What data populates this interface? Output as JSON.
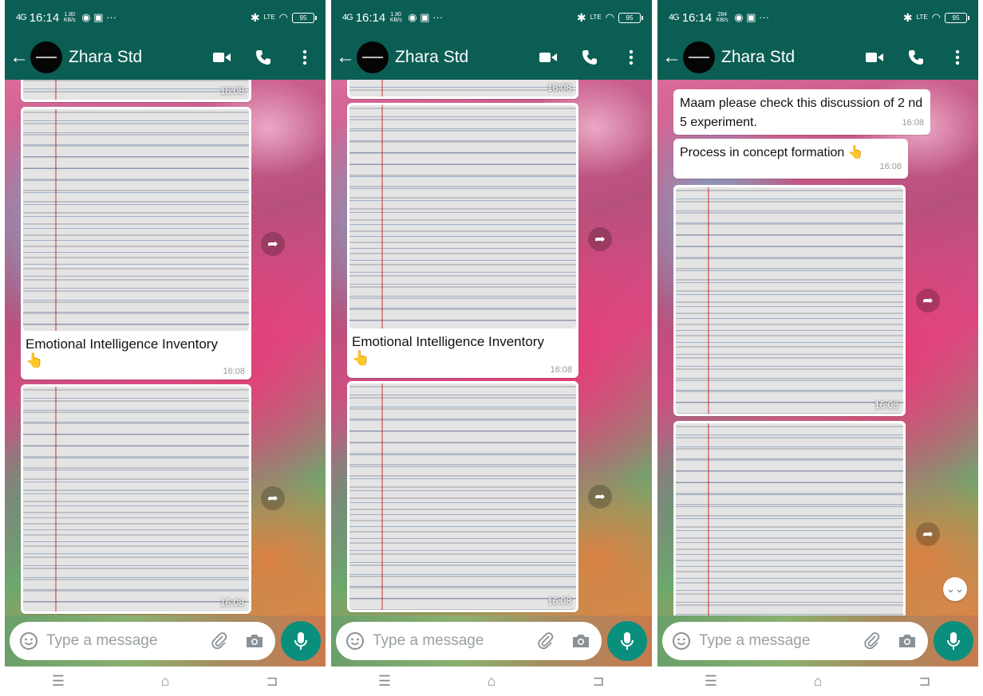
{
  "status_bar": {
    "signal": "4G",
    "time": "16:14",
    "network_speeds": [
      "1.80",
      "1.80",
      "284"
    ],
    "network_unit": "KB/s",
    "battery": "95",
    "lte": "LTE"
  },
  "chat_header": {
    "contact_name": "Zhara Std"
  },
  "screens": [
    {
      "messages": [
        {
          "type": "image",
          "time": "16:08"
        },
        {
          "type": "image_caption",
          "caption": "Emotional Intelligence Inventory",
          "emoji": "👆",
          "time": "16:08"
        },
        {
          "type": "image",
          "time": "16:08"
        }
      ]
    },
    {
      "messages": [
        {
          "type": "image",
          "time": "16:08"
        },
        {
          "type": "image_caption",
          "caption": "Emotional Intelligence Inventory",
          "emoji": "👆",
          "time": "16:08"
        },
        {
          "type": "image",
          "time": "16:08"
        }
      ]
    },
    {
      "messages": [
        {
          "type": "text",
          "text": "Maam please check this discussion of 2 nd 5 experiment.",
          "time": "16:08"
        },
        {
          "type": "text",
          "text": "Process in concept formation 👆",
          "time": "16:08"
        },
        {
          "type": "image",
          "time": "16:08"
        },
        {
          "type": "image"
        }
      ]
    }
  ],
  "composer": {
    "placeholder": "Type a message"
  },
  "icons": {
    "back": "arrow-left-icon",
    "video": "video-call-icon",
    "phone": "phone-call-icon",
    "menu": "more-vert-icon",
    "emoji": "emoji-icon",
    "attach": "paperclip-icon",
    "camera": "camera-icon",
    "mic": "microphone-icon",
    "forward": "forward-icon",
    "scroll": "double-chevron-down-icon"
  },
  "colors": {
    "header": "#0b5e54",
    "mic_button": "#0b8f7d",
    "bubble": "#ffffff"
  }
}
